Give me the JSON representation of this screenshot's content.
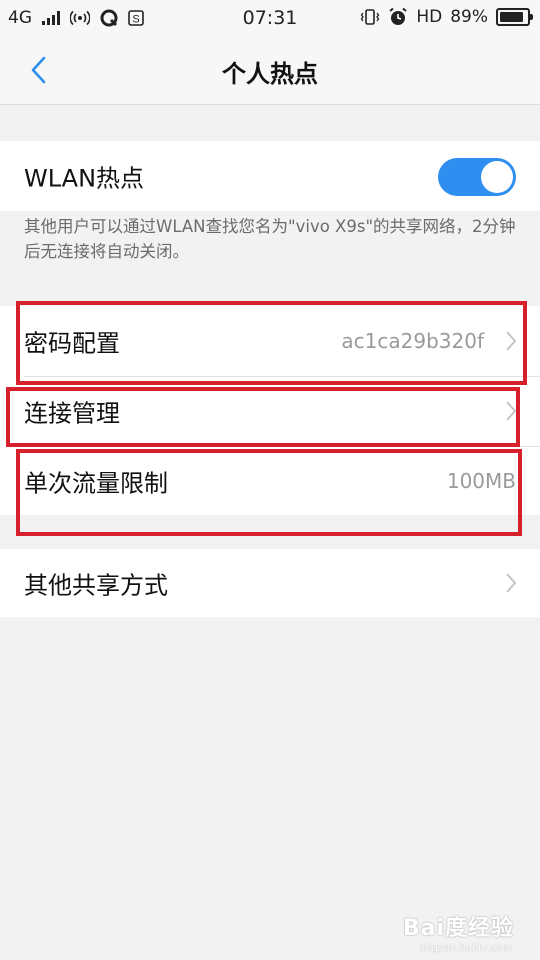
{
  "status_bar": {
    "network": "4G",
    "time": "07:31",
    "hd": "HD",
    "battery": "89%",
    "battery_level": 0.89
  },
  "header": {
    "title": "个人热点"
  },
  "hotspot": {
    "label": "WLAN热点",
    "enabled": true,
    "description": "其他用户可以通过WLAN查找您名为\"vivo X9s\"的共享网络，2分钟后无连接将自动关闭。"
  },
  "settings": {
    "password_label": "密码配置",
    "password_value": "ac1ca29b320f",
    "connection_label": "连接管理",
    "data_limit_label": "单次流量限制",
    "data_limit_value": "100MB"
  },
  "other": {
    "share_label": "其他共享方式"
  },
  "watermark": {
    "text": "Bai度经验",
    "sub": "jingyan.baidu.com"
  },
  "colors": {
    "accent": "#2f8ff0",
    "annotation": "#d6202b"
  }
}
